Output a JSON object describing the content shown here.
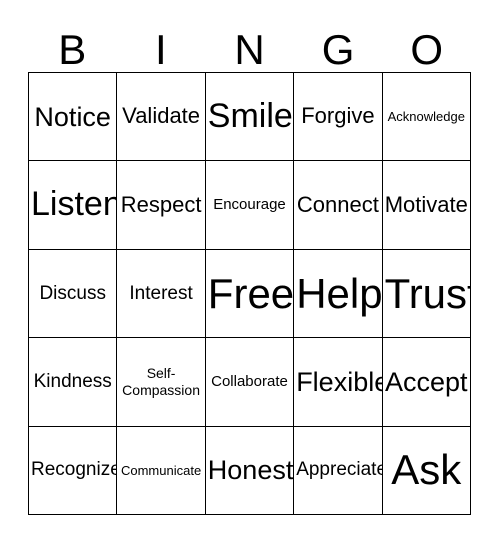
{
  "card": {
    "header_letters": [
      "B",
      "I",
      "N",
      "G",
      "O"
    ],
    "columns": 5,
    "rows": 5,
    "border_color": "#000000",
    "background_color": "#ffffff",
    "text_color": "#000000",
    "free_space_label": "Free!",
    "free_space_position": "center",
    "cells": [
      [
        {
          "label": "Notice",
          "size": "l"
        },
        {
          "label": "Validate",
          "size": "m"
        },
        {
          "label": "Smile",
          "size": "xl"
        },
        {
          "label": "Forgive",
          "size": "m"
        },
        {
          "label": "Acknowledge",
          "size": "xxs"
        }
      ],
      [
        {
          "label": "Listen",
          "size": "xl"
        },
        {
          "label": "Respect",
          "size": "m"
        },
        {
          "label": "Encourage",
          "size": "xs"
        },
        {
          "label": "Connect",
          "size": "m"
        },
        {
          "label": "Motivate",
          "size": "m"
        }
      ],
      [
        {
          "label": "Discuss",
          "size": "s"
        },
        {
          "label": "Interest",
          "size": "s"
        },
        {
          "label": "Free!",
          "size": "xxl"
        },
        {
          "label": "Help",
          "size": "xxl"
        },
        {
          "label": "Trust",
          "size": "xxl"
        }
      ],
      [
        {
          "label": "Kindness",
          "size": "s"
        },
        {
          "label": "Self-\nCompassion",
          "size": "two"
        },
        {
          "label": "Collaborate",
          "size": "xs"
        },
        {
          "label": "Flexible",
          "size": "l"
        },
        {
          "label": "Accept",
          "size": "l"
        }
      ],
      [
        {
          "label": "Recognize",
          "size": "s"
        },
        {
          "label": "Communicate",
          "size": "xxs"
        },
        {
          "label": "Honesty",
          "size": "l"
        },
        {
          "label": "Appreciate",
          "size": "s"
        },
        {
          "label": "Ask",
          "size": "xxl"
        }
      ]
    ]
  }
}
